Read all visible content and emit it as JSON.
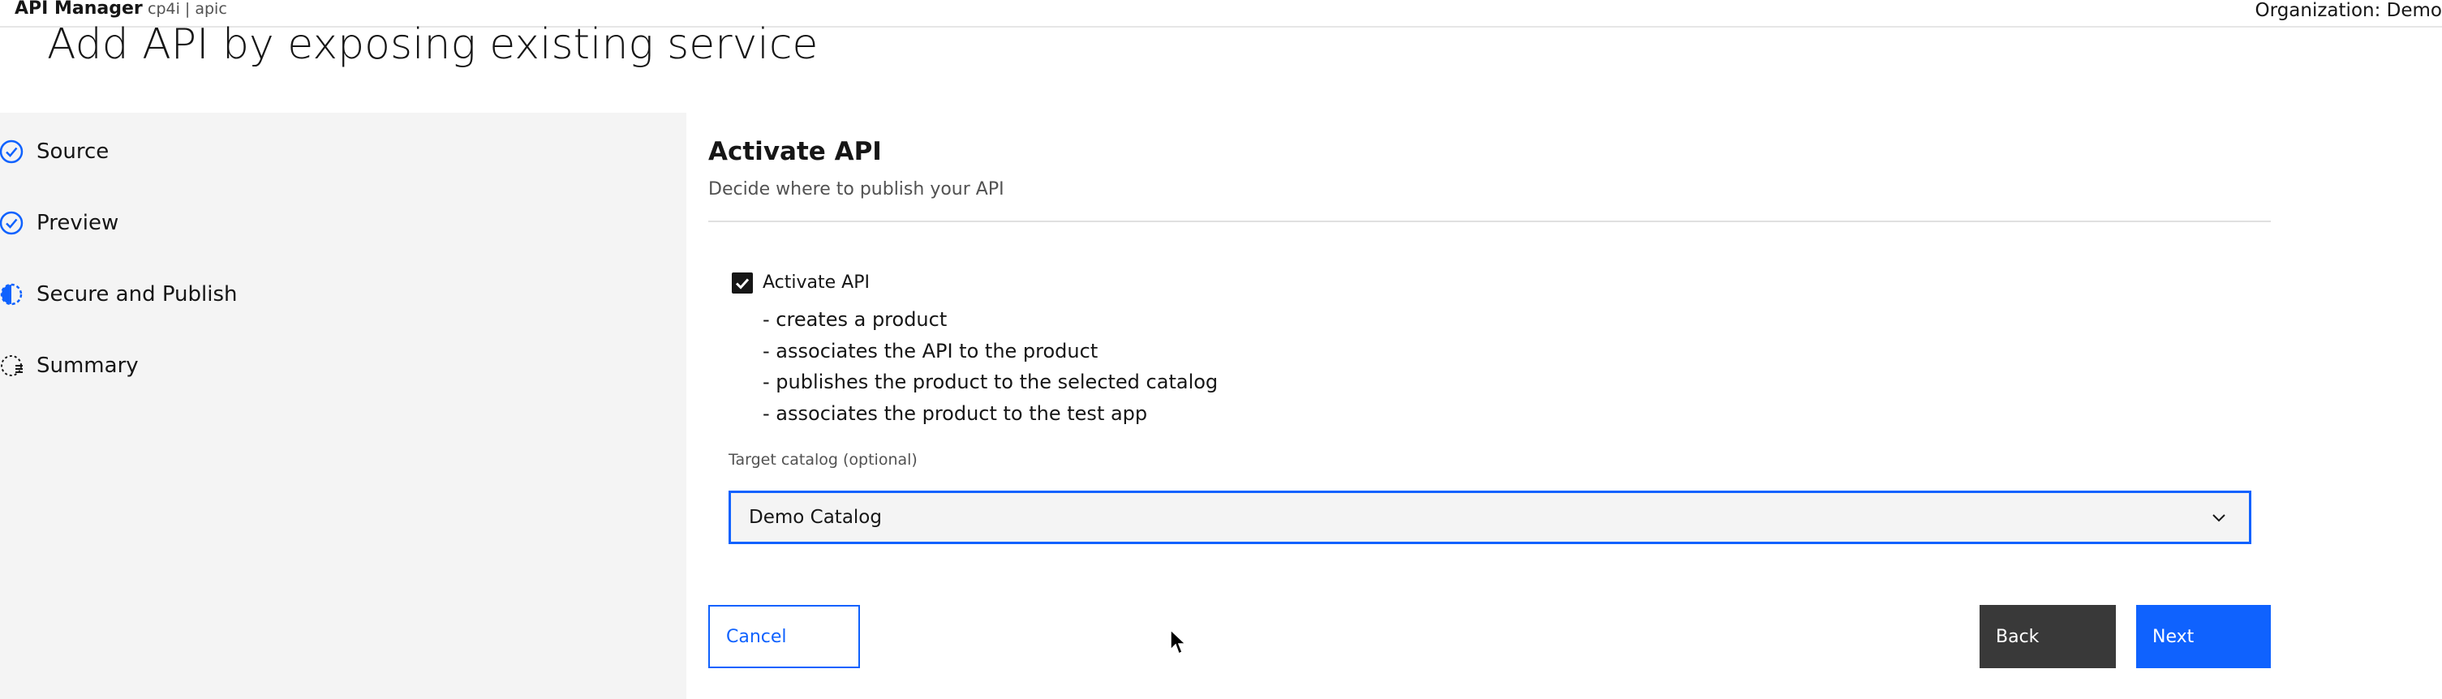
{
  "header": {
    "app_name": "API Manager",
    "breadcrumb": "cp4i  |  apic",
    "organization": "Organization:  Demo"
  },
  "page": {
    "title": "Add API by exposing existing service"
  },
  "steps": [
    {
      "label": "Source",
      "state": "complete"
    },
    {
      "label": "Preview",
      "state": "complete"
    },
    {
      "label": "Secure and Publish",
      "state": "current"
    },
    {
      "label": "Summary",
      "state": "incomplete"
    }
  ],
  "section": {
    "title": "Activate API",
    "subtitle": "Decide where to publish your API"
  },
  "activate": {
    "label": "Activate API",
    "checked": true,
    "bullets": [
      "- creates a product",
      "- associates the API to the product",
      "- publishes the product to the selected catalog",
      "- associates the product to the test app"
    ]
  },
  "catalog": {
    "label": "Target catalog (optional)",
    "value": "Demo Catalog"
  },
  "buttons": {
    "cancel": "Cancel",
    "back": "Back",
    "next": "Next"
  },
  "colors": {
    "accent": "#0f62fe",
    "rail_bg": "#f4f4f4",
    "back_button": "#393939"
  }
}
